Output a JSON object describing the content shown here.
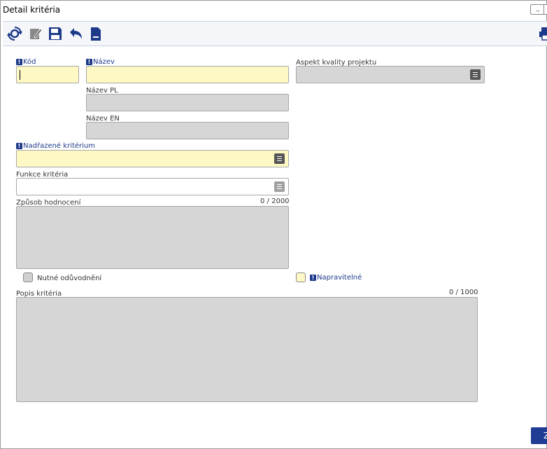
{
  "window": {
    "title": "Detail kritéria",
    "minimize_label": "_"
  },
  "toolbar": {
    "icons": [
      "refresh-icon",
      "edit-icon",
      "save-icon",
      "undo-icon",
      "new-document-icon",
      "print-icon"
    ]
  },
  "form": {
    "kod": {
      "label": "Kód",
      "value": ""
    },
    "nazev": {
      "label": "Název",
      "value": ""
    },
    "nazev_pl": {
      "label": "Název PL",
      "value": ""
    },
    "nazev_en": {
      "label": "Název EN",
      "value": ""
    },
    "aspekt": {
      "label": "Aspekt kvality projektu",
      "value": ""
    },
    "nadrazene": {
      "label": "Nadřazené kritérium",
      "value": ""
    },
    "funkce": {
      "label": "Funkce kritéria",
      "value": ""
    },
    "zpusob": {
      "label": "Způsob hodnocení",
      "counter": "0 / 2000",
      "value": ""
    },
    "nutne": {
      "label": "Nutné odůvodnění",
      "checked": false
    },
    "napravitelne": {
      "label": "Napravitelné",
      "checked": false
    },
    "popis": {
      "label": "Popis kritéria",
      "counter": "0 / 1000",
      "value": ""
    }
  },
  "footer": {
    "button_label": "Z"
  }
}
